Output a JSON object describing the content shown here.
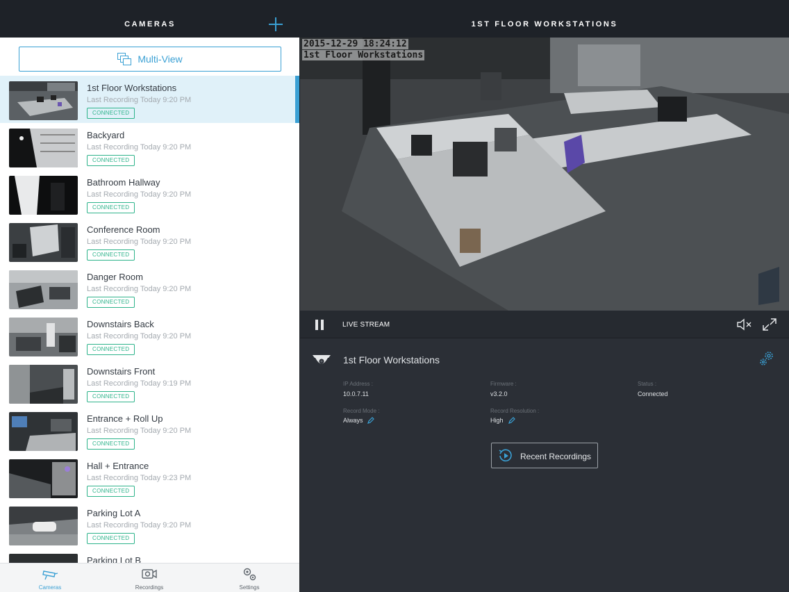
{
  "left": {
    "title": "CAMERAS",
    "multiview_label": "Multi-View",
    "cameras": [
      {
        "name": "1st Floor Workstations",
        "last": "Last Recording Today 9:20 PM",
        "status": "CONNECTED"
      },
      {
        "name": "Backyard",
        "last": "Last Recording Today 9:20 PM",
        "status": "CONNECTED"
      },
      {
        "name": "Bathroom Hallway",
        "last": "Last Recording Today 9:20 PM",
        "status": "CONNECTED"
      },
      {
        "name": "Conference Room",
        "last": "Last Recording Today 9:20 PM",
        "status": "CONNECTED"
      },
      {
        "name": "Danger Room",
        "last": "Last Recording Today 9:20 PM",
        "status": "CONNECTED"
      },
      {
        "name": "Downstairs Back",
        "last": "Last Recording Today 9:20 PM",
        "status": "CONNECTED"
      },
      {
        "name": "Downstairs Front",
        "last": "Last Recording Today 9:19 PM",
        "status": "CONNECTED"
      },
      {
        "name": "Entrance + Roll Up",
        "last": "Last Recording Today 9:20 PM",
        "status": "CONNECTED"
      },
      {
        "name": "Hall + Entrance",
        "last": "Last Recording Today 9:23 PM",
        "status": "CONNECTED"
      },
      {
        "name": "Parking Lot A",
        "last": "Last Recording Today 9:20 PM",
        "status": "CONNECTED"
      },
      {
        "name": "Parking Lot B",
        "last": "",
        "status": ""
      }
    ],
    "tabs": [
      {
        "label": "Cameras",
        "active": true
      },
      {
        "label": "Recordings",
        "active": false
      },
      {
        "label": "Settings",
        "active": false
      }
    ]
  },
  "right": {
    "title": "1ST FLOOR WORKSTATIONS",
    "video": {
      "timestamp": "2015-12-29 18:24:12",
      "overlay_name": "1st Floor Workstations"
    },
    "controls": {
      "live_label": "LIVE STREAM"
    },
    "info": {
      "title": "1st Floor Workstations",
      "ip_label": "IP Address :",
      "ip_value": "10.0.7.11",
      "firmware_label": "Firmware :",
      "firmware_value": "v3.2.0",
      "status_label": "Status :",
      "status_value": "Connected",
      "record_mode_label": "Record Mode :",
      "record_mode_value": "Always",
      "record_res_label": "Record Resolution :",
      "record_res_value": "High",
      "recent_label": "Recent Recordings"
    }
  },
  "colors": {
    "accent": "#3aa0d4",
    "connected": "#2cb38a",
    "dark_header": "#1e2228",
    "panel": "#2b2f36"
  },
  "icons": [
    "add-icon",
    "multiview-icon",
    "pause-icon",
    "mute-icon",
    "fullscreen-icon",
    "camera-dome-icon",
    "gear-icon",
    "pencil-icon",
    "history-icon",
    "cameras-tab-icon",
    "recordings-tab-icon",
    "settings-tab-icon"
  ]
}
